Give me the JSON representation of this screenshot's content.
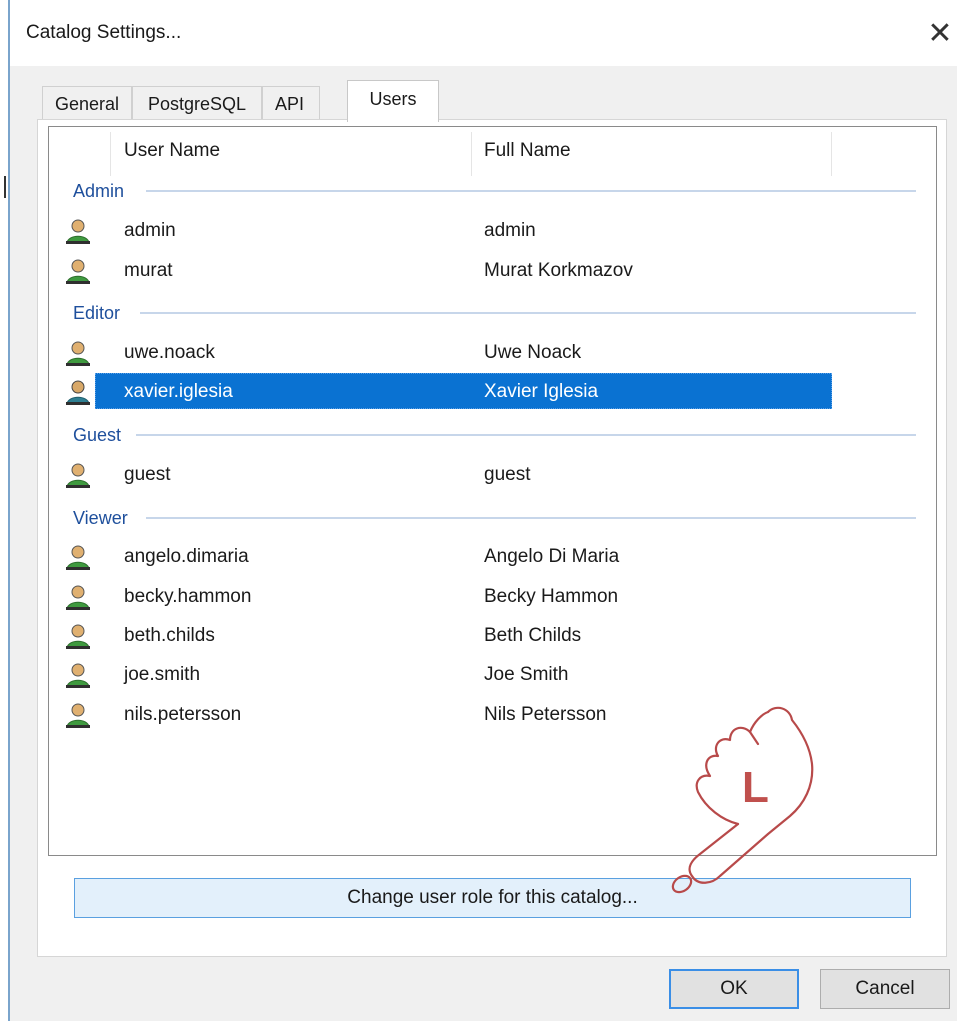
{
  "window": {
    "title": "Catalog Settings..."
  },
  "tabs": [
    {
      "label": "General",
      "active": false
    },
    {
      "label": "PostgreSQL",
      "active": false
    },
    {
      "label": "API",
      "active": false
    },
    {
      "label": "Users",
      "active": true
    }
  ],
  "list": {
    "columns": [
      "User Name",
      "Full Name"
    ],
    "groups": [
      {
        "name": "Admin",
        "users": [
          {
            "username": "admin",
            "fullname": "admin"
          },
          {
            "username": "murat",
            "fullname": "Murat Korkmazov"
          }
        ]
      },
      {
        "name": "Editor",
        "users": [
          {
            "username": "uwe.noack",
            "fullname": "Uwe Noack"
          },
          {
            "username": "xavier.iglesia",
            "fullname": "Xavier Iglesia",
            "selected": true
          }
        ]
      },
      {
        "name": "Guest",
        "users": [
          {
            "username": "guest",
            "fullname": "guest"
          }
        ]
      },
      {
        "name": "Viewer",
        "users": [
          {
            "username": "angelo.dimaria",
            "fullname": "Angelo Di Maria"
          },
          {
            "username": "becky.hammon",
            "fullname": "Becky Hammon"
          },
          {
            "username": "beth.childs",
            "fullname": "Beth Childs"
          },
          {
            "username": "joe.smith",
            "fullname": "Joe Smith"
          },
          {
            "username": "nils.petersson",
            "fullname": "Nils Petersson"
          }
        ]
      }
    ]
  },
  "buttons": {
    "change_role": "Change user role for this catalog...",
    "ok": "OK",
    "cancel": "Cancel"
  },
  "overlay": {
    "hand_letter": "L"
  },
  "colors": {
    "selection": "#0a72d2",
    "group_text": "#1e4f9c",
    "accent_border": "#3a8ee6"
  }
}
